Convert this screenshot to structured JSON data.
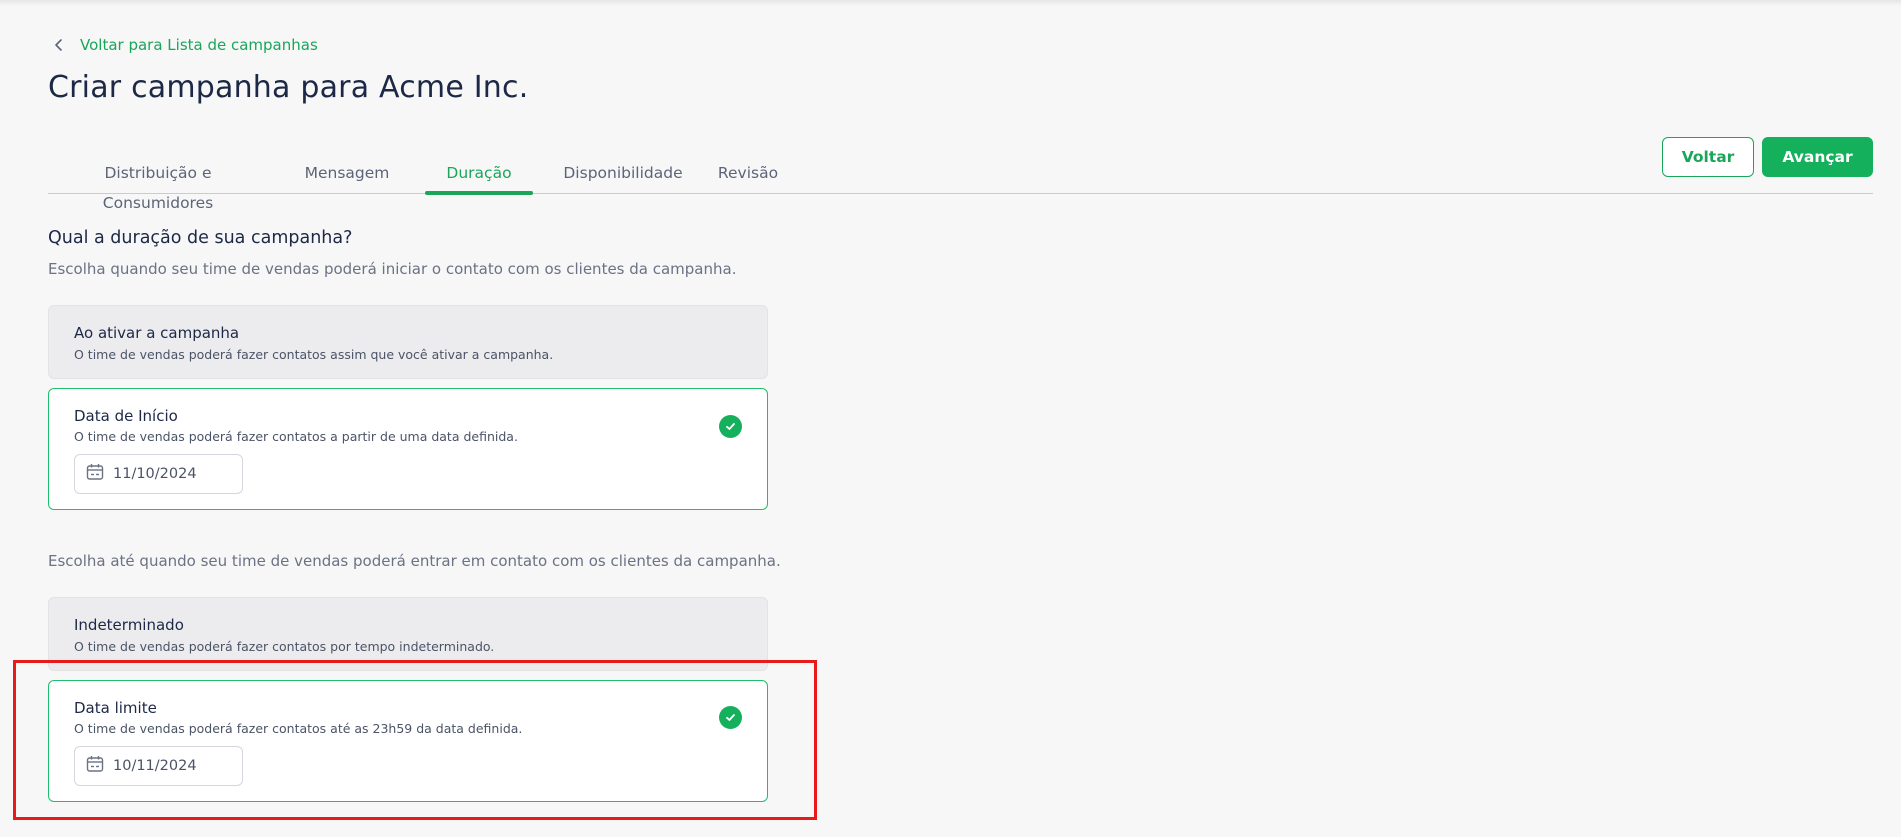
{
  "back_link": {
    "label": "Voltar para Lista de campanhas"
  },
  "page_title": "Criar campanha para Acme Inc.",
  "tabs": [
    {
      "label": "Distribuição e Consumidores",
      "active": false
    },
    {
      "label": "Mensagem",
      "active": false
    },
    {
      "label": "Duração",
      "active": true
    },
    {
      "label": "Disponibilidade",
      "active": false
    },
    {
      "label": "Revisão",
      "active": false
    }
  ],
  "actions": {
    "back_label": "Voltar",
    "next_label": "Avançar"
  },
  "duration": {
    "question": "Qual a duração de sua campanha?",
    "start_subtitle": "Escolha quando seu time de vendas poderá iniciar o contato com os clientes da campanha.",
    "start_options": [
      {
        "title": "Ao ativar a campanha",
        "description": "O time de vendas poderá fazer contatos assim que você ativar a campanha.",
        "selected": false
      },
      {
        "title": "Data de Início",
        "description": "O time de vendas poderá fazer contatos a partir de uma data definida.",
        "selected": true,
        "date": "11/10/2024"
      }
    ],
    "end_subtitle": "Escolha até quando seu time de vendas poderá entrar em contato com os clientes da campanha.",
    "end_options": [
      {
        "title": "Indeterminado",
        "description": "O time de vendas poderá fazer contatos por tempo indeterminado.",
        "selected": false
      },
      {
        "title": "Data limite",
        "description": "O time de vendas poderá fazer contatos até as 23h59 da data definida.",
        "selected": true,
        "date": "10/11/2024"
      }
    ]
  },
  "colors": {
    "accent": "#1aa659",
    "primary_button": "#14b05c",
    "title": "#1c2846",
    "highlight_box": "#e81b1b"
  },
  "icons": {
    "back": "chevron-left-icon",
    "check": "check-circle-icon",
    "calendar": "calendar-icon"
  }
}
